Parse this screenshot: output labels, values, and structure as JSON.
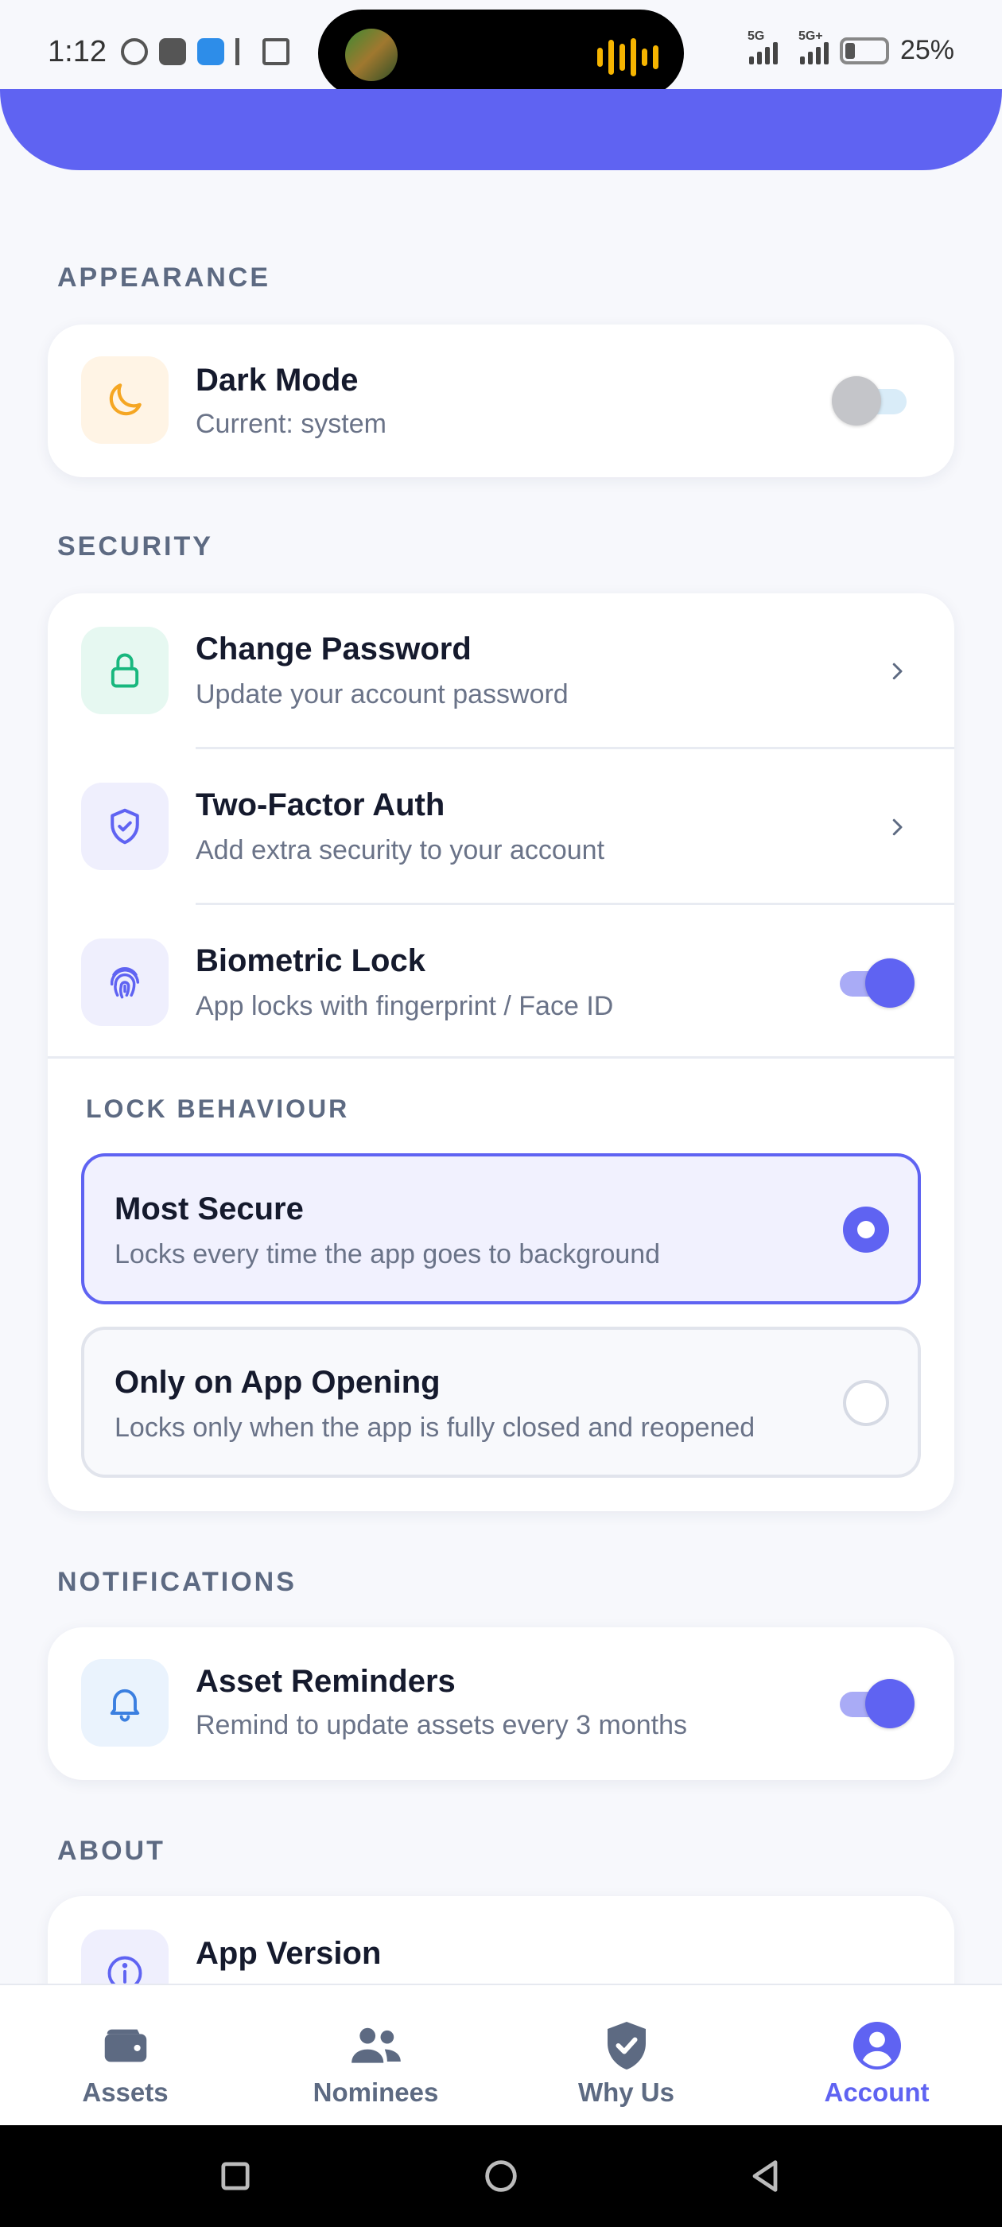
{
  "status_bar": {
    "time": "1:12",
    "network_1": "5G",
    "network_2": "5G+",
    "battery": "25%"
  },
  "colors": {
    "accent": "#5f63f2",
    "background": "#f7f8fc",
    "dark_mode_icon": "#f5a623",
    "password_icon": "#18b77e"
  },
  "sections": {
    "appearance": "APPEARANCE",
    "security": "SECURITY",
    "notifications": "NOTIFICATIONS",
    "about": "ABOUT"
  },
  "appearance": {
    "dark_mode": {
      "title": "Dark Mode",
      "subtitle": "Current: system",
      "enabled": false,
      "icon": "moon-icon"
    }
  },
  "security": {
    "change_password": {
      "title": "Change Password",
      "subtitle": "Update your account password",
      "icon": "lock-icon"
    },
    "two_factor": {
      "title": "Two-Factor Auth",
      "subtitle": "Add extra security to your account",
      "icon": "shield-check-icon"
    },
    "biometric": {
      "title": "Biometric Lock",
      "subtitle": "App locks with fingerprint / Face ID",
      "enabled": true,
      "icon": "fingerprint-icon"
    },
    "lock_behaviour_label": "LOCK BEHAVIOUR",
    "options": [
      {
        "title": "Most Secure",
        "subtitle": "Locks every time the app goes to background",
        "selected": true
      },
      {
        "title": "Only on App Opening",
        "subtitle": "Locks only when the app is fully closed and reopened",
        "selected": false
      }
    ]
  },
  "notifications": {
    "asset_reminders": {
      "title": "Asset Reminders",
      "subtitle": "Remind to update assets every 3 months",
      "enabled": true,
      "icon": "bell-icon"
    }
  },
  "about": {
    "app_version": {
      "title": "App Version",
      "icon": "info-icon"
    }
  },
  "bottom_nav": [
    {
      "label": "Assets",
      "icon": "wallet-icon",
      "active": false
    },
    {
      "label": "Nominees",
      "icon": "people-icon",
      "active": false
    },
    {
      "label": "Why Us",
      "icon": "shield-check-icon",
      "active": false
    },
    {
      "label": "Account",
      "icon": "user-circle-icon",
      "active": true
    }
  ]
}
